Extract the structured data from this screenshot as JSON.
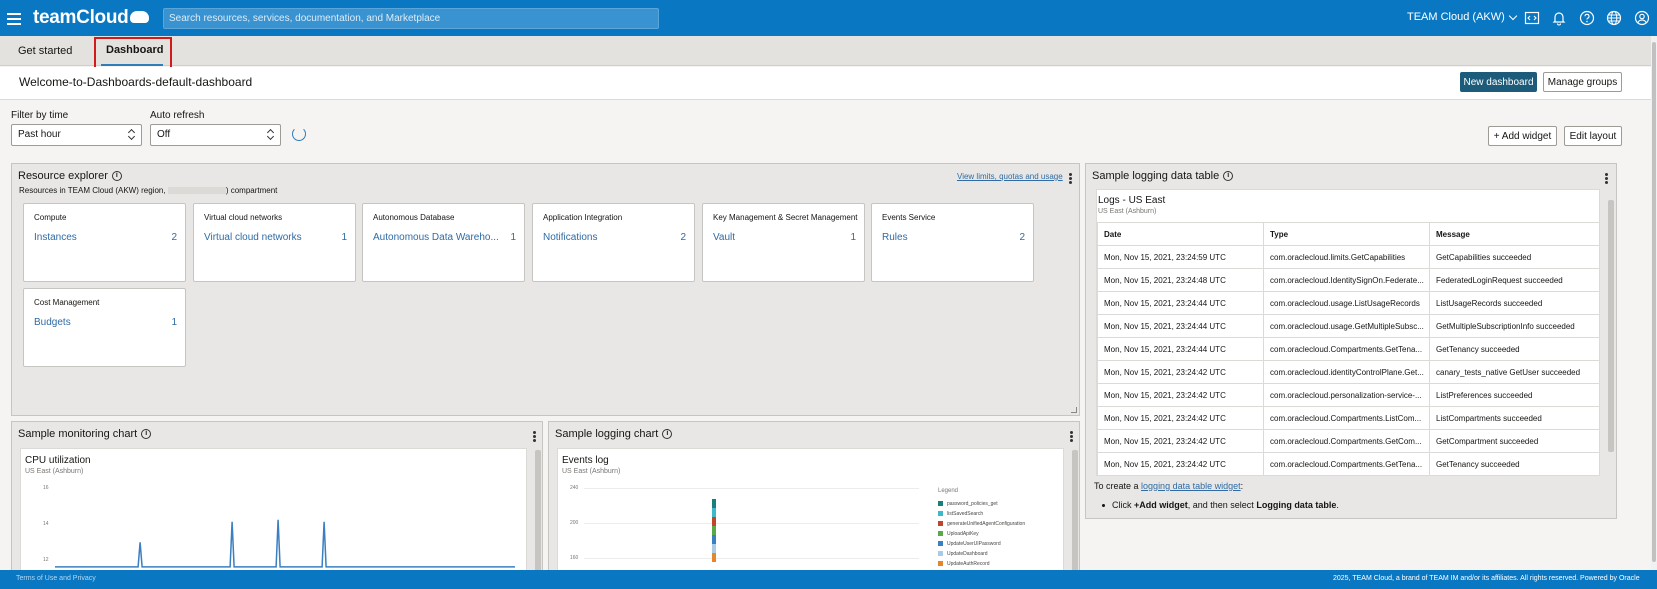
{
  "topbar": {
    "brand": "teamCloud",
    "search_placeholder": "Search resources, services, documentation, and Marketplace",
    "region": "TEAM Cloud (AKW)",
    "icons": [
      "code-editor-icon",
      "bell-icon",
      "help-icon",
      "globe-icon",
      "user-icon"
    ],
    "color": "#0a77c2"
  },
  "tabs": [
    {
      "label": "Get started",
      "active": false
    },
    {
      "label": "Dashboard",
      "active": true
    }
  ],
  "page": {
    "title": "Welcome-to-Dashboards-default-dashboard",
    "new_dashboard": "New dashboard",
    "manage_groups": "Manage groups"
  },
  "filters": {
    "time_label": "Filter by time",
    "time_value": "Past hour",
    "refresh_label": "Auto refresh",
    "refresh_value": "Off",
    "add_widget": "+ Add widget",
    "edit_layout": "Edit layout"
  },
  "resource_explorer": {
    "title": "Resource explorer",
    "subtitle_prefix": "Resources in TEAM Cloud (AKW) region,",
    "subtitle_suffix": ") compartment",
    "link": "View limits, quotas and usage",
    "cards": [
      {
        "title": "Compute",
        "link": "Instances",
        "count": "2"
      },
      {
        "title": "Virtual cloud networks",
        "link": "Virtual cloud networks",
        "count": "1"
      },
      {
        "title": "Autonomous Database",
        "link": "Autonomous Data Wareho...",
        "count": "1"
      },
      {
        "title": "Application Integration",
        "link": "Notifications",
        "count": "2"
      },
      {
        "title": "Key Management & Secret Management",
        "link": "Vault",
        "count": "1"
      },
      {
        "title": "Events Service",
        "link": "Rules",
        "count": "2"
      },
      {
        "title": "Cost Management",
        "link": "Budgets",
        "count": "1"
      }
    ]
  },
  "logging_table": {
    "title": "Sample logging data table",
    "panel_title": "Logs - US East",
    "panel_sub": "US East (Ashburn)",
    "columns": [
      "Date",
      "Type",
      "Message"
    ],
    "rows": [
      [
        "Mon, Nov 15, 2021, 23:24:59 UTC",
        "com.oraclecloud.limits.GetCapabilities",
        "GetCapabilities succeeded"
      ],
      [
        "Mon, Nov 15, 2021, 23:24:48 UTC",
        "com.oraclecloud.IdentitySignOn.Federate...",
        "FederatedLoginRequest succeeded"
      ],
      [
        "Mon, Nov 15, 2021, 23:24:44 UTC",
        "com.oraclecloud.usage.ListUsageRecords",
        "ListUsageRecords succeeded"
      ],
      [
        "Mon, Nov 15, 2021, 23:24:44 UTC",
        "com.oraclecloud.usage.GetMultipleSubsc...",
        "GetMultipleSubscriptionInfo succeeded"
      ],
      [
        "Mon, Nov 15, 2021, 23:24:44 UTC",
        "com.oraclecloud.Compartments.GetTena...",
        "GetTenancy succeeded"
      ],
      [
        "Mon, Nov 15, 2021, 23:24:42 UTC",
        "com.oraclecloud.identityControlPlane.Get...",
        "canary_tests_native GetUser succeeded"
      ],
      [
        "Mon, Nov 15, 2021, 23:24:42 UTC",
        "com.oraclecloud.personalization-service-...",
        "ListPreferences succeeded"
      ],
      [
        "Mon, Nov 15, 2021, 23:24:42 UTC",
        "com.oraclecloud.Compartments.ListCom...",
        "ListCompartments succeeded"
      ],
      [
        "Mon, Nov 15, 2021, 23:24:42 UTC",
        "com.oraclecloud.Compartments.GetCom...",
        "GetCompartment succeeded"
      ],
      [
        "Mon, Nov 15, 2021, 23:24:42 UTC",
        "com.oraclecloud.Compartments.GetTena...",
        "GetTenancy succeeded"
      ]
    ],
    "tip_prefix": "To create a",
    "tip_link": "logging data table widget",
    "tip_suffix": ":",
    "tip_bullet_1": "Click",
    "tip_bullet_bold1": "+Add widget",
    "tip_bullet_2": ", and then select",
    "tip_bullet_bold2": "Logging data table",
    "tip_bullet_3": "."
  },
  "monitoring": {
    "title": "Sample monitoring chart",
    "panel_title": "CPU utilization",
    "panel_sub": "US East (Ashburn)"
  },
  "logging_chart": {
    "title": "Sample logging chart",
    "panel_title": "Events log",
    "panel_sub": "US East (Ashburn)",
    "legend_title": "Legend"
  },
  "chart_data": [
    {
      "type": "line",
      "title": "CPU utilization",
      "y_ticks": [
        "16",
        "14",
        "12"
      ],
      "spikes_x_fraction": [
        0.185,
        0.385,
        0.485,
        0.585
      ],
      "spike_values": [
        13.2,
        14.2,
        14.3,
        14.2
      ],
      "baseline": 12
    },
    {
      "type": "bar",
      "title": "Events log",
      "y_ticks": [
        "240",
        "200",
        "160"
      ],
      "series": [
        {
          "name": "password_policies_get",
          "color": "#1a7f7a"
        },
        {
          "name": "listSavedSearch",
          "color": "#3fb8c9"
        },
        {
          "name": "generateUnifiedAgentConfiguration",
          "color": "#c0462b"
        },
        {
          "name": "UploadApiKey",
          "color": "#5aa84a"
        },
        {
          "name": "UpdateUserUIPassword",
          "color": "#3a7fc1"
        },
        {
          "name": "UpdateDashboard",
          "color": "#a9cbe6"
        },
        {
          "name": "UpdateAuthRecord",
          "color": "#e6862b"
        }
      ]
    }
  ],
  "footer": {
    "left": "Terms of Use and Privacy",
    "right": "2025, TEAM Cloud, a brand of TEAM IM and/or its affiliates. All rights reserved.    Powered by Oracle"
  }
}
